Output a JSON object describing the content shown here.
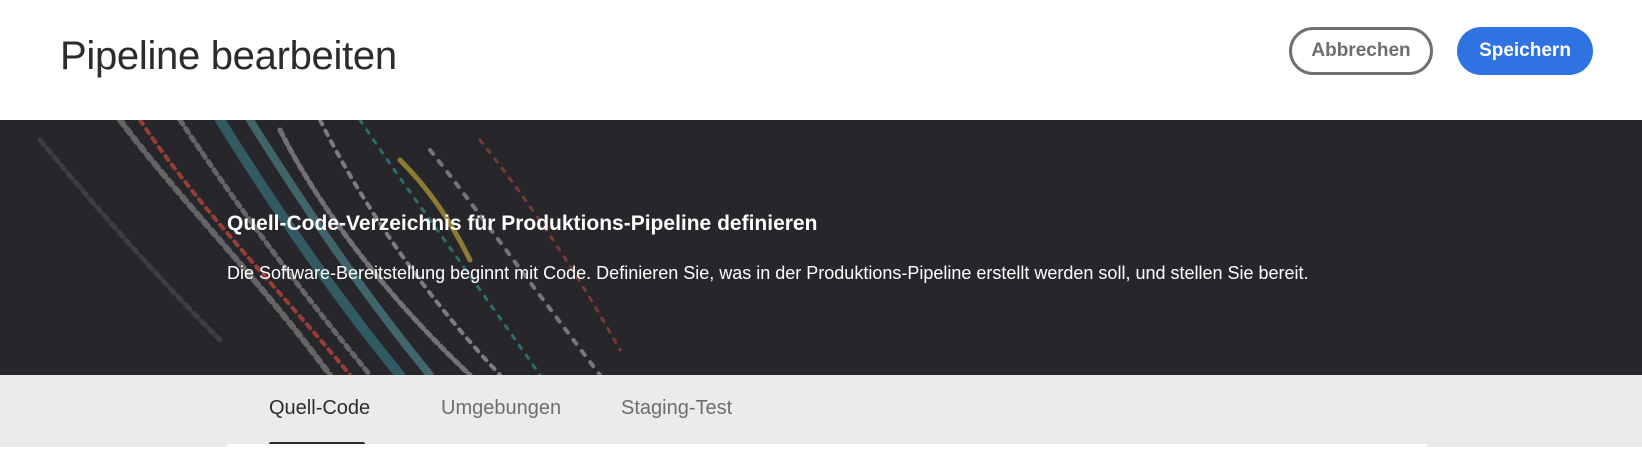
{
  "header": {
    "title": "Pipeline bearbeiten",
    "cancel_label": "Abbrechen",
    "save_label": "Speichern"
  },
  "hero": {
    "title": "Quell-Code-Verzeichnis für Produktions-Pipeline definieren",
    "description": "Die Software-Bereitstellung beginnt mit Code. Definieren Sie, was in der Produktions-Pipeline erstellt werden soll, und stellen Sie bereit."
  },
  "tabs": [
    {
      "label": "Quell-Code",
      "active": true
    },
    {
      "label": "Umgebungen",
      "active": false
    },
    {
      "label": "Staging-Test",
      "active": false
    }
  ],
  "colors": {
    "accent": "#2f73e3",
    "hero_background": "#27262b",
    "tabbar_background": "#ebebeb"
  }
}
